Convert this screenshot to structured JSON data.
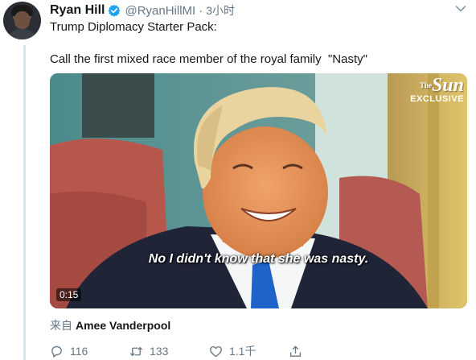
{
  "tweet": {
    "author_name": "Ryan Hill",
    "handle": "@RyanHillMI",
    "separator": "·",
    "time": "3小时",
    "line1": "Trump Diplomacy Starter Pack:",
    "line2": "Call the first mixed race member of the royal family  \"Nasty\""
  },
  "video": {
    "logo_main": "Sun",
    "logo_prefix": "The",
    "logo_sub": "EXCLUSIVE",
    "subtitle": "No I didn't know that she was nasty.",
    "duration": "0:15"
  },
  "source": {
    "prefix": "来自",
    "author": "Amee Vanderpool"
  },
  "actions": {
    "reply_count": "116",
    "retweet_count": "133",
    "like_count": "1.1千"
  },
  "colors": {
    "verified": "#1da1f2",
    "secondary_text": "#657786",
    "tie": "#1e63c8"
  },
  "icons": [
    "verified-badge-icon",
    "chevron-down-icon",
    "reply-icon",
    "retweet-icon",
    "like-icon",
    "share-icon"
  ]
}
